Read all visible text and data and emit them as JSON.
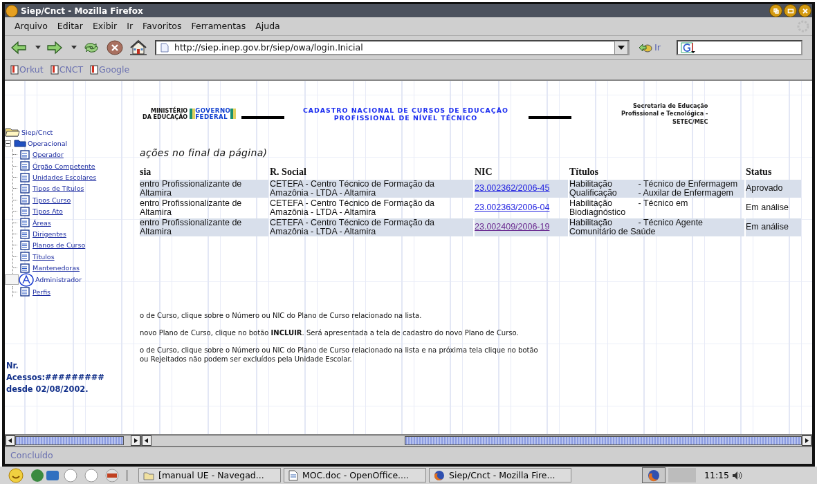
{
  "window": {
    "title": "Siep/Cnct - Mozilla Firefox"
  },
  "menu": [
    {
      "label": "Arquivo"
    },
    {
      "label": "Editar"
    },
    {
      "label": "Exibir"
    },
    {
      "label": "Ir"
    },
    {
      "label": "Favoritos"
    },
    {
      "label": "Ferramentas"
    },
    {
      "label": "Ajuda"
    }
  ],
  "toolbar": {
    "url": "http://siep.inep.gov.br/siep/owa/login.Inicial",
    "go_label": "Ir"
  },
  "bookmarks": [
    "Orkut",
    "CNCT",
    "Google"
  ],
  "sidebar": {
    "tree": [
      {
        "label": "Siep/Cnct",
        "kind": "root",
        "children": [
          {
            "label": "Operacional",
            "kind": "folder",
            "expanded": true,
            "children": [
              {
                "label": "Operador",
                "kind": "page"
              },
              {
                "label": "Órgão Competente",
                "kind": "page"
              },
              {
                "label": "Unidades Escolares",
                "kind": "page"
              },
              {
                "label": "Tipos de Títulos",
                "kind": "page"
              },
              {
                "label": "Tipos Curso",
                "kind": "page"
              },
              {
                "label": "Tipos Ato",
                "kind": "page"
              },
              {
                "label": "Áreas",
                "kind": "page"
              },
              {
                "label": "Dirigentes",
                "kind": "page"
              },
              {
                "label": "Planos de Curso",
                "kind": "page"
              },
              {
                "label": "Títulos",
                "kind": "page"
              },
              {
                "label": "Mantenedoras",
                "kind": "page"
              }
            ]
          },
          {
            "label": "Administrador",
            "kind": "admin",
            "children": [
              {
                "label": "Perfis",
                "kind": "page"
              }
            ]
          }
        ]
      }
    ],
    "access_counter": [
      "Nr.",
      "Acessos:#########",
      "desde 02/08/2002."
    ]
  },
  "header": {
    "ministry": [
      "MINISTÉRIO",
      "DA EDUCAÇÃO"
    ],
    "government": [
      "GOVERNO",
      "FEDERAL"
    ],
    "title": [
      "CADASTRO NACIONAL DE CURSOS DE EDUCAÇÃO",
      "PROFISSIONAL DE NÍVEL TÉCNICO"
    ],
    "secretariat": [
      "Secretaria de Educação",
      "Profissional e Tecnológica -",
      "SETEC/MEC"
    ]
  },
  "note": "ações no final da página)",
  "table": {
    "columns": [
      "sia",
      "R. Social",
      "NIC",
      "Títulos",
      "Status"
    ],
    "rows": [
      {
        "unit": "entro Profissionalizante de Altamira",
        "social": "CETEFA - Centro Técnico de Formação da Amazônia - LTDA - Altamira",
        "nic": "23.002362/2006-45",
        "visited": false,
        "titles": [
          {
            "type": "Habilitação",
            "name": "- Técnico de Enfermagem"
          },
          {
            "type": "Qualificação",
            "name": "- Auxilar de Enfermagem"
          }
        ],
        "status": "Aprovado"
      },
      {
        "unit": "entro Profissionalizante de Altamira",
        "social": "CETEFA - Centro Técnico de Formação da Amazônia - LTDA - Altamira",
        "nic": "23.002363/2006-04",
        "visited": false,
        "titles": [
          {
            "type": "Habilitação",
            "name": "- Técnico em Biodiagnóstico"
          }
        ],
        "status": "Em análise"
      },
      {
        "unit": "entro Profissionalizante de Altamira",
        "social": "CETEFA - Centro Técnico de Formação da Amazônia - LTDA - Altamira",
        "nic": "23.002409/2006-19",
        "visited": true,
        "titles": [
          {
            "type": "Habilitação",
            "name": "- Técnico Agente Comunitário de Saúde"
          }
        ],
        "status": "Em análise"
      }
    ]
  },
  "instructions": [
    "o de Curso, clique sobre o Número ou NIC do Plano de Curso relacionado na lista.",
    "novo Plano de Curso, clique no botão **INCLUIR**. Será apresentada a tela de cadastro do novo Plano de Curso.",
    "o de Curso, clique sobre o Número ou NIC do Plano de Curso relacionado na lista e na próxima tela clique no botão",
    "ou Rejeitados não podem ser excluídos pela Unidade Escolar."
  ],
  "status_bar": "Concluído",
  "taskbar": {
    "tasks": [
      {
        "label": "[manual UE - Navegad...",
        "kind": "folder"
      },
      {
        "label": "MOC.doc - OpenOffice....",
        "kind": "document"
      },
      {
        "label": "Siep/Cnct - Mozilla Fire...",
        "kind": "browser"
      }
    ],
    "clock": "11:15"
  }
}
